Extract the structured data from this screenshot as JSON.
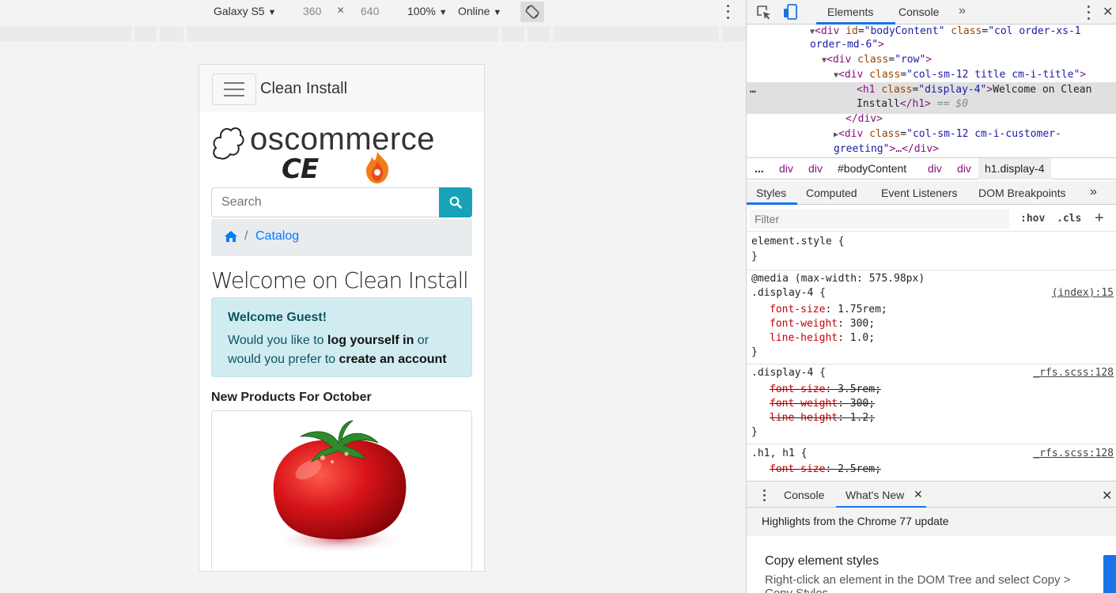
{
  "device_toolbar": {
    "device": "Galaxy S5",
    "width": "360",
    "times": "×",
    "height": "640",
    "zoom": "100%",
    "network": "Online",
    "caret": "▼"
  },
  "site": {
    "brand": "Clean Install",
    "logo_word": "oscommerce",
    "logo_sub": "CE PHOENIX",
    "search_placeholder": "Search",
    "breadcrumb_sep": "/",
    "breadcrumb_catalog": "Catalog",
    "welcome_title": "Welcome on Clean Install",
    "greeting": {
      "title": "Welcome Guest!",
      "text1": "Would you like to ",
      "login": "log yourself in",
      "text2": " or would you prefer to ",
      "create": "create an account"
    },
    "new_products": "New Products For October"
  },
  "devtools": {
    "tabs": {
      "elements": "Elements",
      "console": "Console",
      "more": "»"
    },
    "close": "✕",
    "dom": {
      "l1_tag_open": "<div ",
      "l1_attr1": "id",
      "l1_val1": "\"bodyContent\"",
      "l1_attr2": "class",
      "l1_val2": "\"col order-xs-1",
      "l1b_val": "order-md-6\"",
      "l2_tag": "<div ",
      "l2_attr": "class",
      "l2_val": "\"row\"",
      "l3_tag": "<div ",
      "l3_attr": "class",
      "l3_val": "\"col-sm-12 title cm-i-title\"",
      "l4_tag": "<h1 ",
      "l4_attr": "class",
      "l4_val": "\"display-4\"",
      "l4_text": "Welcome on Clean",
      "l4b_text": "Install",
      "l4b_close": "</h1>",
      "l4b_eq": " == $0",
      "l5": "</div>",
      "l6_tag": "<div ",
      "l6_attr": "class",
      "l6_val": "\"col-sm-12 cm-i-customer-",
      "l6b_val": "greeting\"",
      "l6b_rest": ">…</div>",
      "ellipsis": "…"
    },
    "breadcrumb": {
      "dots": "...",
      "div1": "div",
      "div2": "div",
      "body": "#bodyContent",
      "div3": "div",
      "div4": "div",
      "h1": "h1.display-4"
    },
    "styles_tabs": {
      "styles": "Styles",
      "computed": "Computed",
      "listeners": "Event Listeners",
      "dom_bp": "DOM Breakpoints",
      "more": "»"
    },
    "filter_placeholder": "Filter",
    "hov": ":hov",
    "cls": ".cls",
    "plus": "+",
    "rules": {
      "element_style": "element.style {",
      "close": "}",
      "media": "@media (max-width: 575.98px)",
      "sel1": ".display-4 {",
      "src1": "(index):15",
      "p1a_n": "font-size",
      "p1a_v": "1.75rem;",
      "p1b_n": "font-weight",
      "p1b_v": "300;",
      "p1c_n": "line-height",
      "p1c_v": "1.0;",
      "sel2": ".display-4 {",
      "src2": "_rfs.scss:128",
      "p2a_n": "font-size",
      "p2a_v": "3.5rem;",
      "p2b_n": "font-weight",
      "p2b_v": "300;",
      "p2c_n": "line-height",
      "p2c_v": "1.2;",
      "sel3": ".h1, h1 {",
      "src3": "_rfs.scss:128",
      "p3a_n": "font-size",
      "p3a_v": "2.5rem;"
    },
    "drawer": {
      "console": "Console",
      "whatsnew": "What's New",
      "x": "✕",
      "close": "✕"
    },
    "whatsnew": {
      "highlights": "Highlights from the Chrome 77 update",
      "heading": "Copy element styles",
      "body": "Right-click an element in the DOM Tree and select Copy > Copy Styles"
    }
  }
}
